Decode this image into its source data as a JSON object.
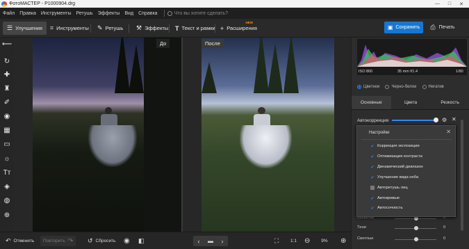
{
  "window": {
    "title": "ФотоМАСТЕР - P1000904.drg",
    "controls": [
      "—",
      "□",
      "✕"
    ]
  },
  "menu": {
    "items": [
      "Файл",
      "Правка",
      "Инструменты",
      "Ретушь",
      "Эффекты",
      "Вид",
      "Справка"
    ],
    "search_placeholder": "Что вы хотите сделать?"
  },
  "toolbar": {
    "tabs": [
      {
        "label": "Улучшения",
        "icon": "sliders-icon"
      },
      {
        "label": "Инструменты",
        "icon": "crop-icon"
      },
      {
        "label": "Ретушь",
        "icon": "brush-icon"
      },
      {
        "label": "Эффекты",
        "icon": "magic-wand-icon"
      },
      {
        "label": "Текст и рамки",
        "icon": "text-icon"
      },
      {
        "label": "Расширения",
        "icon": "plus-icon",
        "badge": "NEW"
      }
    ],
    "save_label": "Сохранить",
    "print_label": "Печать"
  },
  "canvas": {
    "before_label": "До",
    "after_label": "После"
  },
  "histogram": {
    "iso": "ISO 800",
    "lens": "35 mm f/1.4",
    "shutter": "1/80"
  },
  "color_mode": {
    "options": [
      "Цветное",
      "Черно-белое",
      "Негатив"
    ],
    "selected": "Цветное"
  },
  "panel_tabs": {
    "items": [
      "Основные",
      "Цвета",
      "Резкость"
    ],
    "active": "Основные"
  },
  "autocorrection": {
    "label": "Автокоррекция"
  },
  "settings_popup": {
    "title": "Настройки",
    "items": [
      {
        "label": "Коррекция экспозиции",
        "checked": true
      },
      {
        "label": "Оптимизация контраста",
        "checked": true
      },
      {
        "label": "Динамический диапазон",
        "checked": true
      },
      {
        "label": "Улучшение вида неба",
        "checked": true
      },
      {
        "label": "Авторетушь лиц",
        "checked": false
      },
      {
        "label": "Автокривые",
        "checked": true
      },
      {
        "label": "Автосочность",
        "checked": true
      }
    ]
  },
  "sliders": [
    {
      "label": "Засветки",
      "value": "0"
    },
    {
      "label": "Тени",
      "value": "0"
    },
    {
      "label": "Светлые",
      "value": "0"
    }
  ],
  "bottombar": {
    "undo_label": "Отменить",
    "redo_label": "Повторить",
    "reset_label": "Сбросить",
    "zoom_ratio": "1:1",
    "zoom_percent": "9%"
  },
  "colors": {
    "accent": "#1677d2",
    "new_badge": "#ff8a00"
  }
}
